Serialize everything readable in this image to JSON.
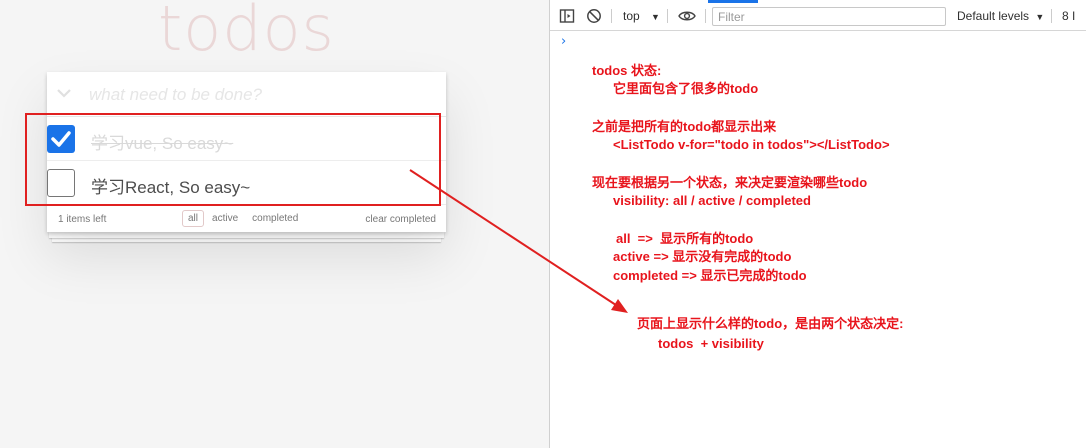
{
  "app": {
    "title": "todos",
    "new_todo_placeholder": "what need to be done?",
    "toggle_all_glyph": "❯",
    "todos": [
      {
        "text": "学习vue, So easy~",
        "completed": true
      },
      {
        "text": "学习React, So easy~",
        "completed": false
      }
    ],
    "footer": {
      "count_text": "1 items left",
      "filters": [
        "all",
        "active",
        "completed"
      ],
      "selected_filter": "all",
      "clear_label": "clear completed"
    }
  },
  "devtools": {
    "context": "top",
    "filter_placeholder": "Filter",
    "levels_label": "Default levels",
    "issues_label": "8 I",
    "prompt_glyph": "›"
  },
  "notes": {
    "line1": "todos 状态:",
    "line2": "它里面包含了很多的todo",
    "line3": "之前是把所有的todo都显示出来",
    "line4": "<ListTodo v-for=\"todo in todos\"></ListTodo>",
    "line5": "现在要根据另一个状态，来决定要渲染哪些todo",
    "line6": "visibility: all / active / completed",
    "line7": "all  =>  显示所有的todo",
    "line8": "active => 显示没有完成的todo",
    "line9": "completed => 显示已完成的todo",
    "line10": "页面上显示什么样的todo，是由两个状态决定:",
    "line11": "todos  + visibility"
  },
  "colors": {
    "annotation": "#e02020",
    "checkbox_checked": "#1a73e8",
    "title_color": "#efd5d5"
  }
}
